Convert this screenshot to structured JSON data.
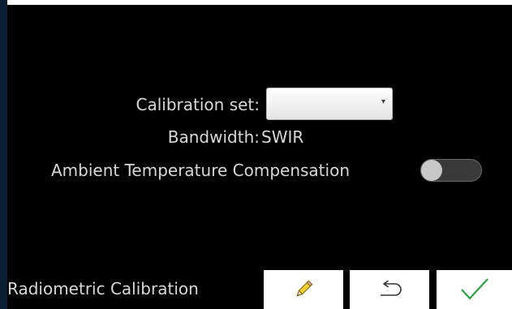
{
  "form": {
    "calibration_set_label": "Calibration set:",
    "calibration_set_value": "",
    "bandwidth_label": "Bandwidth:",
    "bandwidth_value": "SWIR",
    "ambient_temp_label": "Ambient Temperature Compensation",
    "ambient_temp_enabled": false
  },
  "footer": {
    "title": "Radiometric Calibration",
    "buttons": [
      {
        "name": "edit",
        "icon": "pencil-icon"
      },
      {
        "name": "back",
        "icon": "back-arrow-icon"
      },
      {
        "name": "confirm",
        "icon": "checkmark-icon"
      }
    ]
  },
  "colors": {
    "background": "#000000",
    "text": "#d8d8d8",
    "button_bg": "#ffffff",
    "checkmark": "#2ea043",
    "pencil": "#f2d22e"
  }
}
